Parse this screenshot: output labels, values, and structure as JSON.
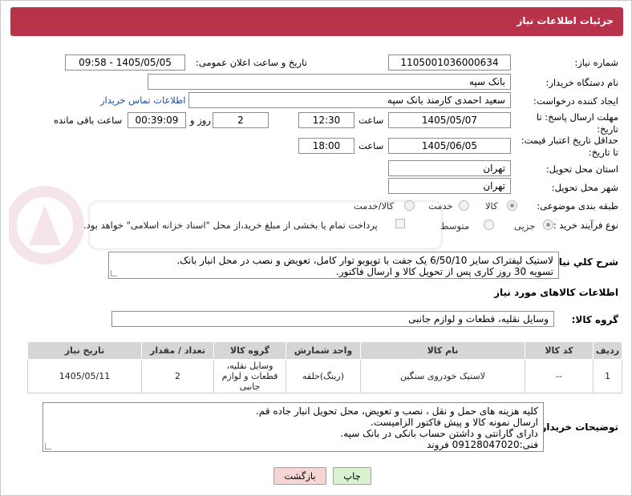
{
  "header": {
    "title": "جزئیات اطلاعات نیاز"
  },
  "fields": {
    "need_number_label": "شماره نیاز:",
    "need_number": "1105001036000634",
    "announce_label": "تاریخ و ساعت اعلان عمومی:",
    "announce_value": "1405/05/05 - 09:58",
    "buyer_org_label": "نام دستگاه خریدار:",
    "buyer_org": "بانک سپه",
    "creator_label": "ایجاد کننده درخواست:",
    "creator": "سعید احمدی کارمند بانک سپه",
    "buyer_contact_link": "اطلاعات تماس خریدار",
    "deadline_label": "مهلت ارسال پاسخ: تا تاریخ:",
    "deadline_date": "1405/05/07",
    "time_label": "ساعت",
    "deadline_time": "12:30",
    "days_value": "2",
    "days_label": "روز و",
    "remaining_time": "00:39:09",
    "remaining_label": "ساعت باقی مانده",
    "validity_label": "حداقل تاریخ اعتبار قیمت: تا تاریخ:",
    "validity_date": "1405/06/05",
    "validity_time": "18:00",
    "province_label": "استان محل تحویل:",
    "province": "تهران",
    "city_label": "شهر محل تحویل:",
    "city": "تهران",
    "category_label": "طبقه بندی موضوعی:",
    "category_options": [
      "کالا",
      "خدمت",
      "کالا/خدمت"
    ],
    "process_label": "نوع فرآیند خرید :",
    "process_options": [
      "جزیی",
      "متوسط"
    ],
    "payment_note": "پرداخت تمام یا بخشی از مبلغ خرید،از محل \"اسناد خزانه اسلامی\" خواهد بود."
  },
  "description": {
    "label": "شرح کلي نياز:",
    "line1": "لاستیک لیفتراک سایز 6/50/10 یک جفت با توپوبو توار کامل، تعویض و نصب در محل انبار بانک.",
    "line2": "تسویه 30 روز کاری پس از تحویل کالا و ارسال فاکتور."
  },
  "goods": {
    "section_title": "اطلاعات کالاهای مورد نیاز",
    "group_label": "گروه کالا:",
    "group_value": "وسایل نقلیه، قطعات و لوازم جانبی",
    "columns": [
      "ردیف",
      "کد کالا",
      "نام کالا",
      "واحد شمارش",
      "گروه کالا",
      "تعداد / مقدار",
      "تاریخ نیاز"
    ],
    "rows": [
      {
        "index": "1",
        "code": "--",
        "name": "لاستیک خودروی سنگین",
        "unit": "(رینگ)حلقه",
        "group_l1": "وسایل نقلیه،",
        "group_l2": "قطعات و لوازم",
        "group_l3": "جانبی",
        "qty": "2",
        "date": "1405/05/11"
      }
    ]
  },
  "buyer_notes": {
    "label": "توضیحات خریدار:",
    "line1": "کلیه هزینه های حمل و نقل ، نصب و تعویض، محل تحویل انبار جاده قم.",
    "line2": "ارسال نمونه کالا و پیش فاکتور الزامیست.",
    "line3": "دارای گارانتی و داشتن حساب بانکی در بانک سپه.",
    "line4": "فنی:09128047020 فروند"
  },
  "buttons": {
    "print": "چاپ",
    "back": "بازگشت"
  },
  "colors": {
    "header": "#b8324a",
    "link": "#1a4fb0",
    "print_btn": "#d9f2d0",
    "back_btn": "#f6d5d5"
  }
}
